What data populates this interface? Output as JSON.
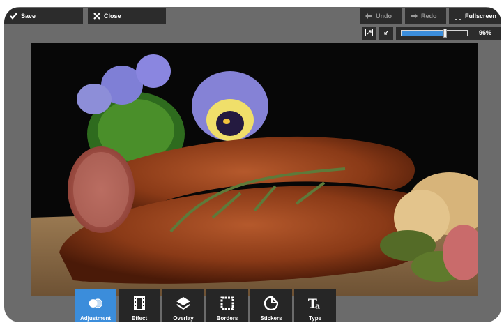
{
  "toolbar": {
    "save": {
      "label": "Save",
      "icon": "checkmark-icon"
    },
    "close": {
      "label": "Close",
      "icon": "x-icon"
    },
    "undo": {
      "label": "Undo",
      "icon": "arrow-left-icon"
    },
    "redo": {
      "label": "Redo",
      "icon": "arrow-right-icon"
    },
    "fullscreen": {
      "label": "Fullscreen",
      "icon": "expand-icon"
    }
  },
  "zoom": {
    "level": 0.96,
    "label": "96%",
    "fit_icon": "fit-to-screen-icon",
    "actual_icon": "actual-size-icon"
  },
  "tools": [
    {
      "label": "Adjustment",
      "icon": "adjustment-icon",
      "active": true
    },
    {
      "label": "Effect",
      "icon": "film-icon",
      "active": false
    },
    {
      "label": "Overlay",
      "icon": "layers-icon",
      "active": false
    },
    {
      "label": "Borders",
      "icon": "border-frame-icon",
      "active": false
    },
    {
      "label": "Stickers",
      "icon": "sticker-icon",
      "active": false
    },
    {
      "label": "Type",
      "icon": "text-type-icon",
      "active": false
    }
  ],
  "colors": {
    "accent": "#3b8ddb",
    "button_bg": "#2c2c2c",
    "frame_bg": "#6b6b6b"
  },
  "canvas": {
    "content": "photo of smoked sausage ring with thyme, bread slices, pickles and pansies"
  }
}
